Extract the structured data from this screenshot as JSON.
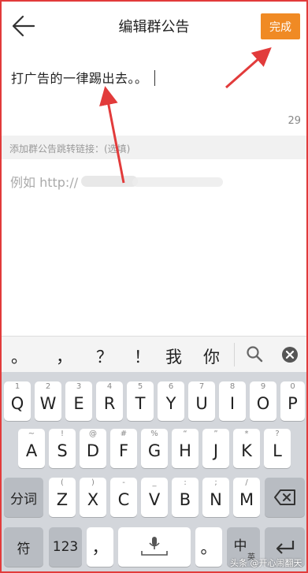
{
  "header": {
    "title": "编辑群公告",
    "done_label": "完成"
  },
  "editor": {
    "content": "打广告的一律踢出去。。",
    "char_count": "29"
  },
  "link": {
    "label": "添加群公告跳转链接：(选填)",
    "placeholder": "例如 http://"
  },
  "suggestions": [
    "。",
    "，",
    "？",
    "！",
    "我",
    "你"
  ],
  "keyboard": {
    "row1": [
      {
        "main": "Q",
        "hint": "1"
      },
      {
        "main": "W",
        "hint": "2"
      },
      {
        "main": "E",
        "hint": "3"
      },
      {
        "main": "R",
        "hint": "4"
      },
      {
        "main": "T",
        "hint": "5"
      },
      {
        "main": "Y",
        "hint": "6"
      },
      {
        "main": "U",
        "hint": "7"
      },
      {
        "main": "I",
        "hint": "8"
      },
      {
        "main": "O",
        "hint": "9"
      },
      {
        "main": "P",
        "hint": "0"
      }
    ],
    "row2": [
      {
        "main": "A",
        "hint": "~"
      },
      {
        "main": "S",
        "hint": "!"
      },
      {
        "main": "D",
        "hint": "@"
      },
      {
        "main": "F",
        "hint": "#"
      },
      {
        "main": "G",
        "hint": "%"
      },
      {
        "main": "H",
        "hint": "“"
      },
      {
        "main": "J",
        "hint": "”"
      },
      {
        "main": "K",
        "hint": "*"
      },
      {
        "main": "L",
        "hint": "?"
      }
    ],
    "row3": [
      {
        "main": "Z",
        "hint": "("
      },
      {
        "main": "X",
        "hint": ")"
      },
      {
        "main": "C",
        "hint": "-"
      },
      {
        "main": "V",
        "hint": "_"
      },
      {
        "main": "B",
        "hint": ":"
      },
      {
        "main": "N",
        "hint": ";"
      },
      {
        "main": "M",
        "hint": "/"
      }
    ],
    "fenci_label": "分词",
    "symbol_label": "符",
    "num_label": "123",
    "comma_label": "，",
    "period_label": "。",
    "lang_label": "中",
    "lang_sub": "英"
  },
  "watermark": "头条 @开心闹翻天",
  "colors": {
    "accent": "#f08a24",
    "annotation": "#e23b3b",
    "keyboard_bg": "#d3d6db"
  }
}
